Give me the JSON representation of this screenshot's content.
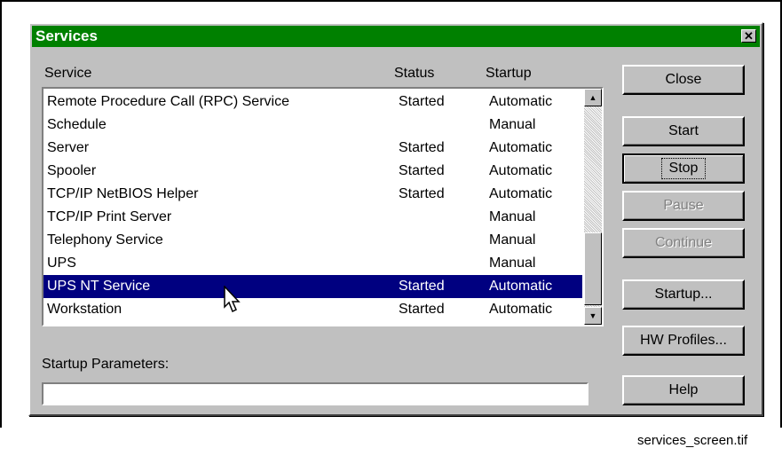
{
  "window": {
    "title": "Services"
  },
  "columns": {
    "service": "Service",
    "status": "Status",
    "startup": "Startup"
  },
  "services": [
    {
      "name": "Remote Procedure Call (RPC) Service",
      "status": "Started",
      "startup": "Automatic"
    },
    {
      "name": "Schedule",
      "status": "",
      "startup": "Manual"
    },
    {
      "name": "Server",
      "status": "Started",
      "startup": "Automatic"
    },
    {
      "name": "Spooler",
      "status": "Started",
      "startup": "Automatic"
    },
    {
      "name": "TCP/IP NetBIOS Helper",
      "status": "Started",
      "startup": "Automatic"
    },
    {
      "name": "TCP/IP Print Server",
      "status": "",
      "startup": "Manual"
    },
    {
      "name": "Telephony Service",
      "status": "",
      "startup": "Manual"
    },
    {
      "name": "UPS",
      "status": "",
      "startup": "Manual"
    },
    {
      "name": "UPS NT Service",
      "status": "Started",
      "startup": "Automatic"
    },
    {
      "name": "Workstation",
      "status": "Started",
      "startup": "Automatic"
    }
  ],
  "selected_row": 8,
  "startup_parameters": {
    "label": "Startup Parameters:",
    "value": ""
  },
  "buttons": {
    "close": "Close",
    "start": "Start",
    "stop": "Stop",
    "pause": "Pause",
    "continue": "Continue",
    "startup": "Startup...",
    "hw_profiles": "HW Profiles...",
    "help": "Help"
  },
  "caption": "services_screen.tif",
  "icons": {
    "close": "close-icon",
    "scroll_up": "scroll-up-arrow-icon",
    "scroll_down": "scroll-down-arrow-icon",
    "cursor": "mouse-pointer-icon"
  },
  "colors": {
    "titlebar": "#008000",
    "selection": "#000080",
    "face": "#c0c0c0"
  }
}
